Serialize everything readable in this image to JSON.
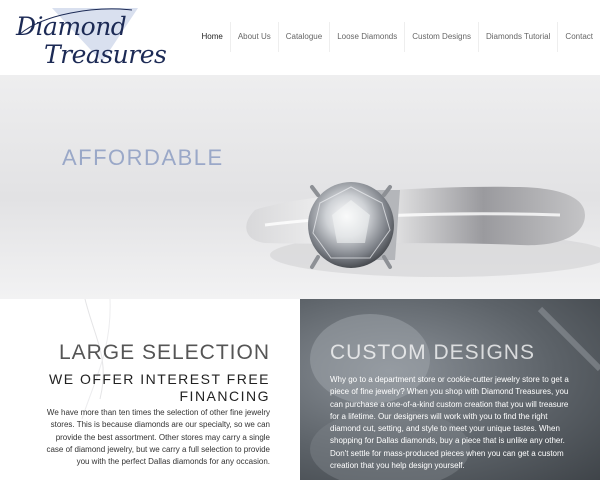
{
  "brand": {
    "line1": "Diamond",
    "line2": "Treasures"
  },
  "nav": [
    {
      "label": "Home",
      "active": true
    },
    {
      "label": "About Us"
    },
    {
      "label": "Catalogue"
    },
    {
      "label": "Loose Diamonds"
    },
    {
      "label": "Custom Designs"
    },
    {
      "label": "Diamonds Tutorial"
    },
    {
      "label": "Contact"
    }
  ],
  "hero": {
    "text": "AFFORDABLE"
  },
  "left_panel": {
    "title": "LARGE SELECTION",
    "subtitle": "WE OFFER INTEREST FREE FINANCING",
    "body": "We have more than ten times the selection of other fine jewelry stores. This is because diamonds are our specialty, so we can provide the best assortment. Other stores may carry a single case of diamond jewelry, but we carry a full selection to provide you with the perfect Dallas diamonds for any occasion."
  },
  "right_panel": {
    "title": "CUSTOM DESIGNS",
    "body": "Why go to a department store or cookie-cutter jewelry store to get a piece of fine jewelry? When you shop with Diamond Treasures, you can purchase a one-of-a-kind custom creation that you will treasure for a lifetime. Our designers will work with you to find the right diamond cut, setting, and style to meet your unique tastes. When shopping for Dallas diamonds, buy a piece that is unlike any other. Don't settle for mass-produced pieces when you can get a custom creation that you help design yourself."
  },
  "colors": {
    "brand_navy": "#1c2a55",
    "hero_text": "#9aa8c8"
  }
}
